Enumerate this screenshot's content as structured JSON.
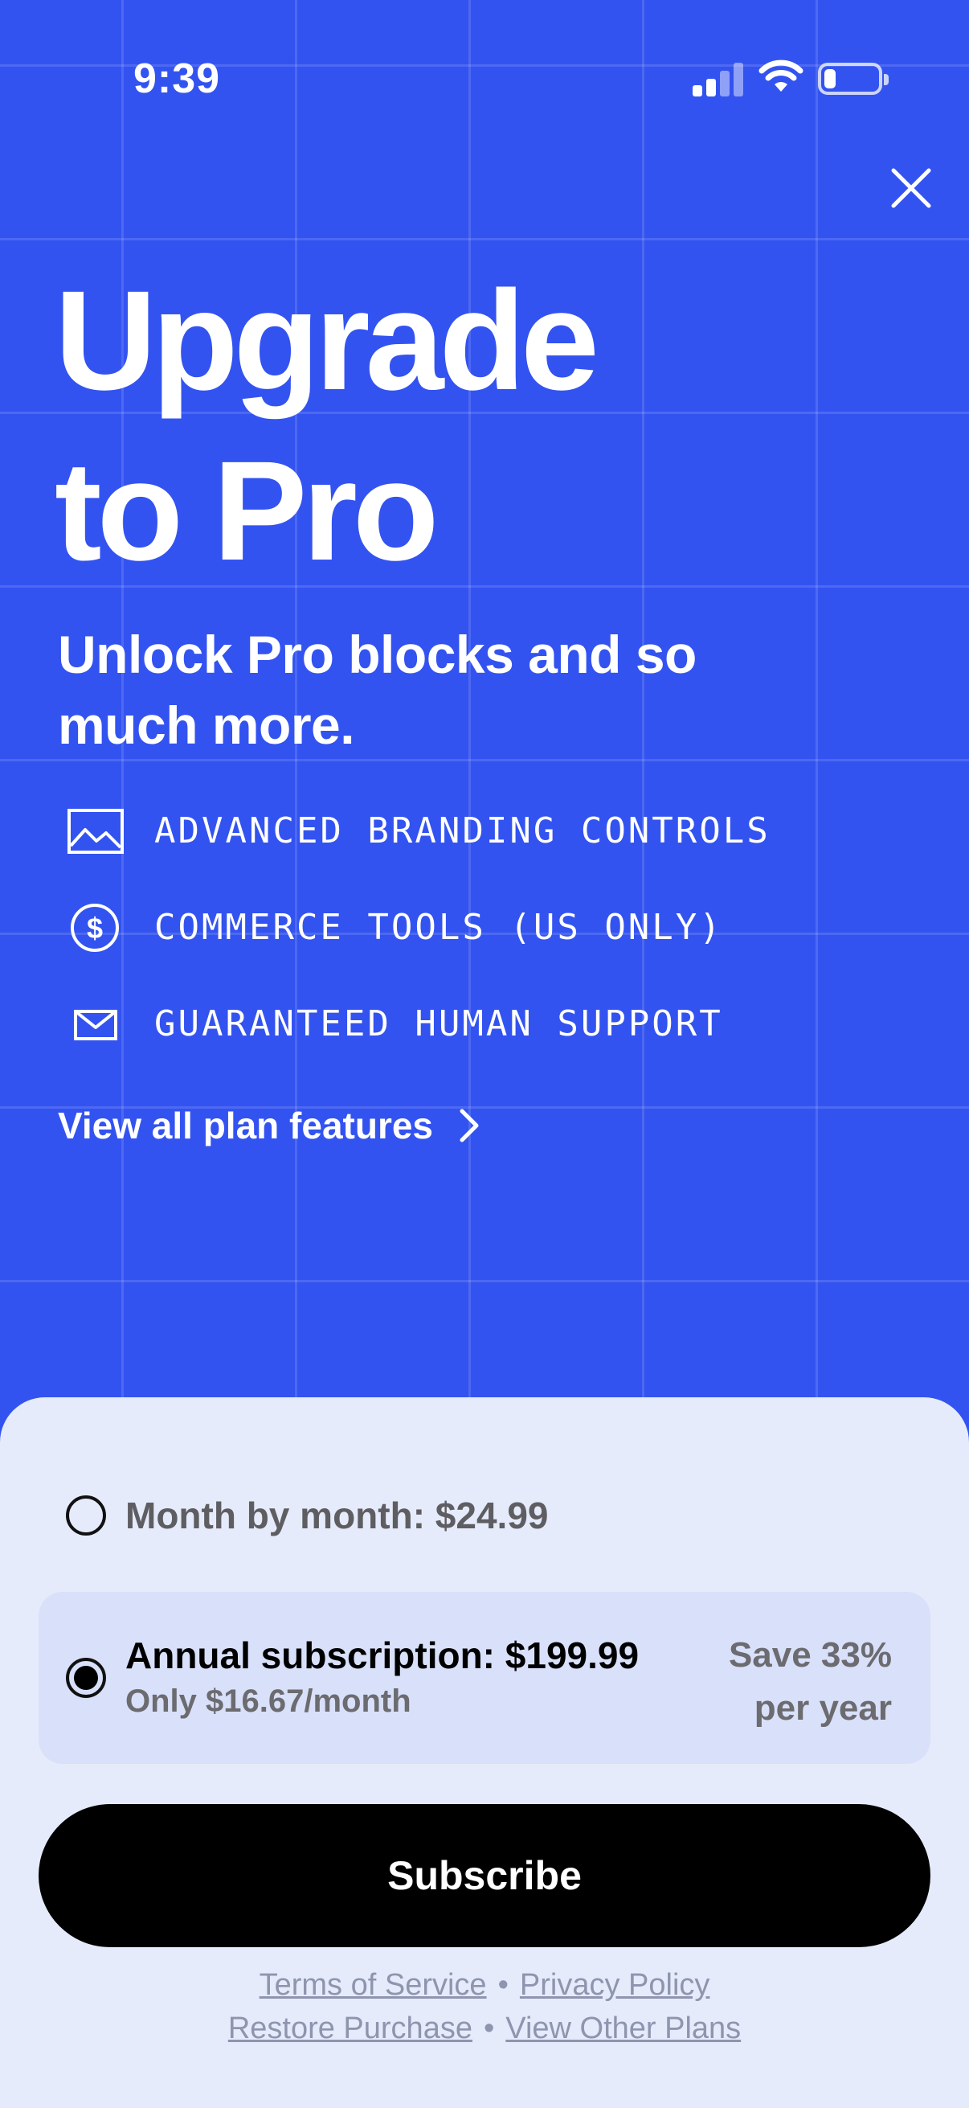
{
  "status_bar": {
    "time": "9:39",
    "icons": [
      "cellular-signal-icon",
      "wifi-icon",
      "battery-icon"
    ]
  },
  "close_icon": "close-icon",
  "headline": {
    "line1": "Upgrade",
    "line2": "to Pro"
  },
  "subheadline": "Unlock Pro blocks and so much more.",
  "features": [
    {
      "icon": "image-icon",
      "label": "ADVANCED BRANDING CONTROLS"
    },
    {
      "icon": "dollar-circle-icon",
      "label": "COMMERCE TOOLS (US ONLY)"
    },
    {
      "icon": "envelope-icon",
      "label": "GUARANTEED HUMAN SUPPORT"
    }
  ],
  "view_all": {
    "label": "View all plan features",
    "icon": "chevron-right-icon"
  },
  "plans": {
    "monthly": {
      "title": "Month by month: $24.99",
      "selected": false
    },
    "annual": {
      "title": "Annual subscription: $199.99",
      "subtitle": "Only $16.67/month",
      "save_line1": "Save 33%",
      "save_line2": "per year",
      "selected": true
    }
  },
  "subscribe_label": "Subscribe",
  "footer_links": {
    "terms": "Terms of Service",
    "privacy": "Privacy Policy",
    "restore": "Restore Purchase",
    "other_plans": "View Other Plans",
    "separator": "•"
  },
  "colors": {
    "brand_blue": "#3353F0",
    "sheet_bg": "#E6EBFB",
    "selected_plan_bg": "#D9E0F9",
    "button_black": "#000000"
  }
}
